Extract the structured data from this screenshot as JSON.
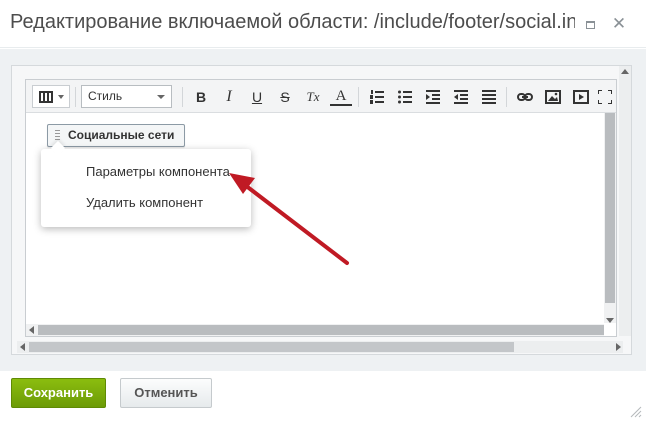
{
  "dialog": {
    "title": "Редактирование включаемой области: /include/footer/social.inc.php"
  },
  "toolbar": {
    "mode_icon": "film-icon",
    "style_select_value": "Стиль",
    "buttons": [
      {
        "name": "bold-button",
        "glyph": "B"
      },
      {
        "name": "italic-button",
        "glyph": "I"
      },
      {
        "name": "underline-button",
        "glyph": "U"
      },
      {
        "name": "strikethrough-button",
        "glyph": "S"
      },
      {
        "name": "clear-format-button",
        "glyph": "Tx"
      },
      {
        "name": "font-color-button",
        "glyph": "A"
      }
    ]
  },
  "editor": {
    "component_label": "Социальные сети",
    "context_menu": [
      "Параметры компонента",
      "Удалить компонент"
    ]
  },
  "footer": {
    "save_label": "Сохранить",
    "cancel_label": "Отменить"
  },
  "colors": {
    "save_button": "#7aad0b",
    "annotation_arrow": "#c01a24"
  }
}
